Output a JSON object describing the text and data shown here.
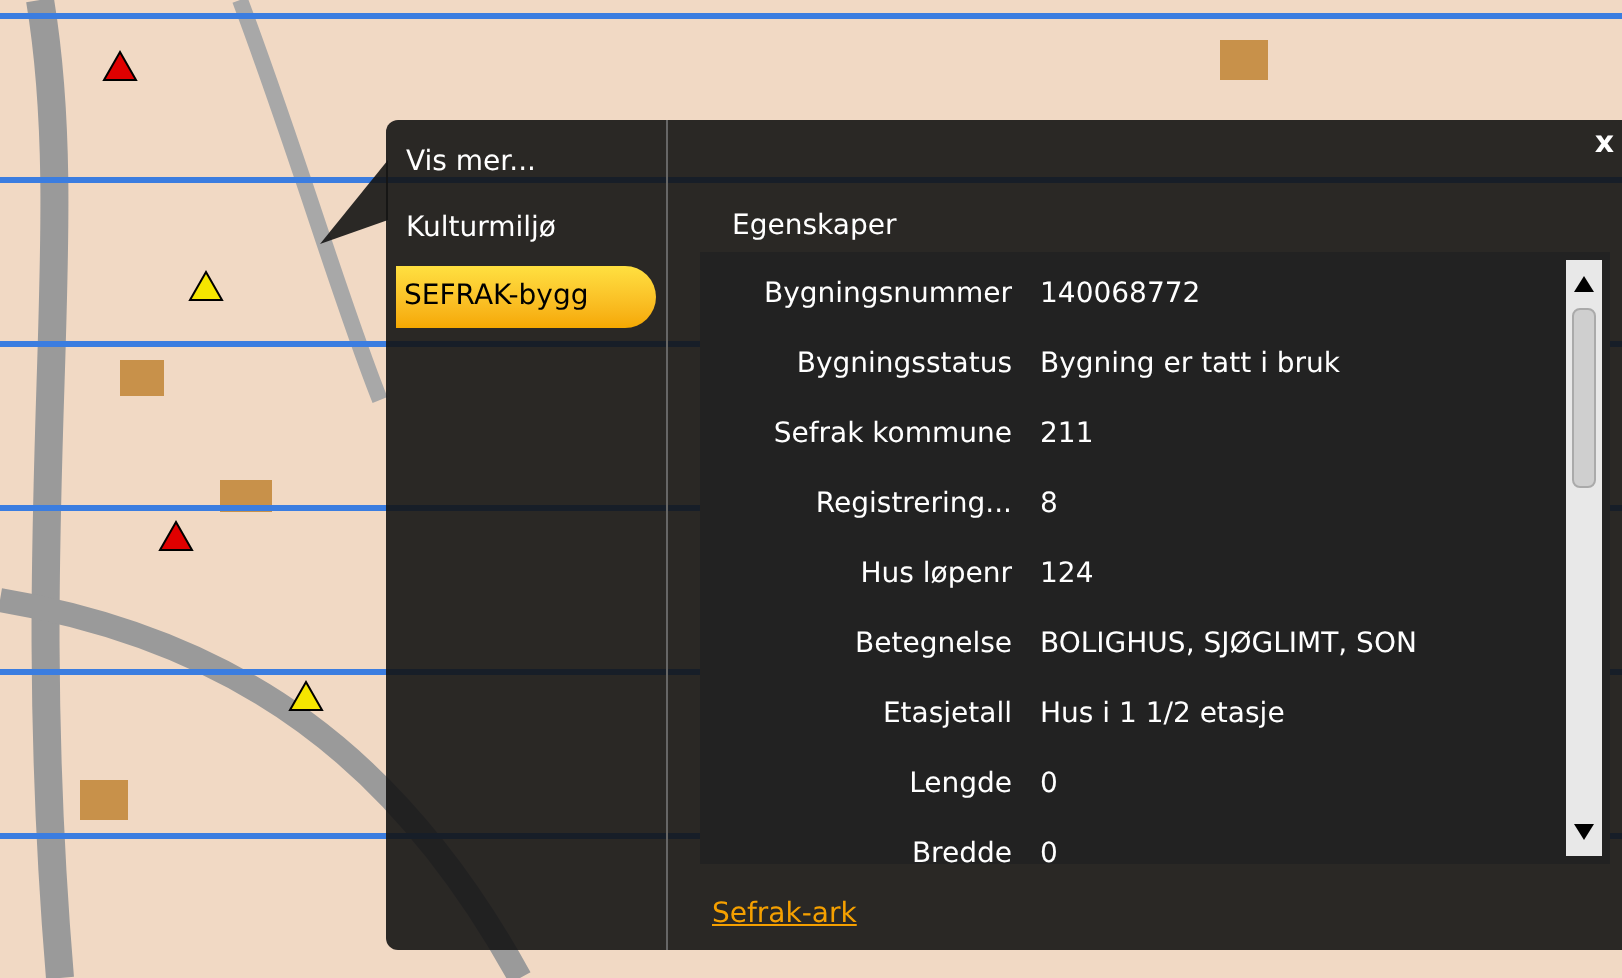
{
  "popup": {
    "close": "x",
    "menu": [
      {
        "label": "Vis mer...",
        "selected": false
      },
      {
        "label": "Kulturmiljø",
        "selected": false
      },
      {
        "label": "SEFRAK-bygg",
        "selected": true
      }
    ],
    "section_title": "Egenskaper",
    "properties": [
      {
        "label": "Bygningsnummer",
        "value": "140068772"
      },
      {
        "label": "Bygningsstatus",
        "value": "Bygning er tatt i bruk"
      },
      {
        "label": "Sefrak kommune",
        "value": "211"
      },
      {
        "label": "Registrering...",
        "value": "8"
      },
      {
        "label": "Hus løpenr",
        "value": "124"
      },
      {
        "label": "Betegnelse",
        "value": "BOLIGHUS, SJØGLIMT, SON"
      },
      {
        "label": "Etasjetall",
        "value": "Hus i 1 1/2 etasje"
      },
      {
        "label": "Lengde",
        "value": "0"
      },
      {
        "label": "Bredde",
        "value": "0"
      }
    ],
    "link": "Sefrak-ark"
  }
}
